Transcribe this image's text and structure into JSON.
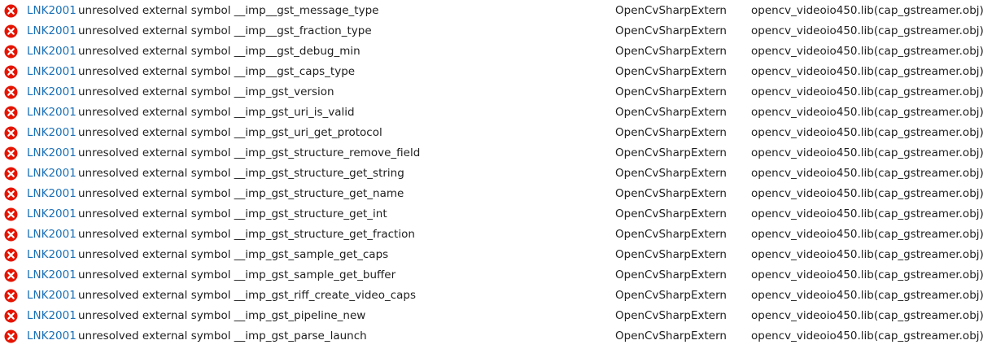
{
  "colors": {
    "error_icon": "#e51400",
    "code_link": "#1a6fb5",
    "text": "#1e1e1e",
    "background": "#ffffff"
  },
  "icons": {
    "row_icon": "error-icon"
  },
  "errors": [
    {
      "code": "LNK2001",
      "description": "unresolved external symbol __imp__gst_message_type",
      "project": "OpenCvSharpExtern",
      "file": "opencv_videoio450.lib(cap_gstreamer.obj)"
    },
    {
      "code": "LNK2001",
      "description": "unresolved external symbol __imp__gst_fraction_type",
      "project": "OpenCvSharpExtern",
      "file": "opencv_videoio450.lib(cap_gstreamer.obj)"
    },
    {
      "code": "LNK2001",
      "description": "unresolved external symbol __imp__gst_debug_min",
      "project": "OpenCvSharpExtern",
      "file": "opencv_videoio450.lib(cap_gstreamer.obj)"
    },
    {
      "code": "LNK2001",
      "description": "unresolved external symbol __imp__gst_caps_type",
      "project": "OpenCvSharpExtern",
      "file": "opencv_videoio450.lib(cap_gstreamer.obj)"
    },
    {
      "code": "LNK2001",
      "description": "unresolved external symbol __imp_gst_version",
      "project": "OpenCvSharpExtern",
      "file": "opencv_videoio450.lib(cap_gstreamer.obj)"
    },
    {
      "code": "LNK2001",
      "description": "unresolved external symbol __imp_gst_uri_is_valid",
      "project": "OpenCvSharpExtern",
      "file": "opencv_videoio450.lib(cap_gstreamer.obj)"
    },
    {
      "code": "LNK2001",
      "description": "unresolved external symbol __imp_gst_uri_get_protocol",
      "project": "OpenCvSharpExtern",
      "file": "opencv_videoio450.lib(cap_gstreamer.obj)"
    },
    {
      "code": "LNK2001",
      "description": "unresolved external symbol __imp_gst_structure_remove_field",
      "project": "OpenCvSharpExtern",
      "file": "opencv_videoio450.lib(cap_gstreamer.obj)"
    },
    {
      "code": "LNK2001",
      "description": "unresolved external symbol __imp_gst_structure_get_string",
      "project": "OpenCvSharpExtern",
      "file": "opencv_videoio450.lib(cap_gstreamer.obj)"
    },
    {
      "code": "LNK2001",
      "description": "unresolved external symbol __imp_gst_structure_get_name",
      "project": "OpenCvSharpExtern",
      "file": "opencv_videoio450.lib(cap_gstreamer.obj)"
    },
    {
      "code": "LNK2001",
      "description": "unresolved external symbol __imp_gst_structure_get_int",
      "project": "OpenCvSharpExtern",
      "file": "opencv_videoio450.lib(cap_gstreamer.obj)"
    },
    {
      "code": "LNK2001",
      "description": "unresolved external symbol __imp_gst_structure_get_fraction",
      "project": "OpenCvSharpExtern",
      "file": "opencv_videoio450.lib(cap_gstreamer.obj)"
    },
    {
      "code": "LNK2001",
      "description": "unresolved external symbol __imp_gst_sample_get_caps",
      "project": "OpenCvSharpExtern",
      "file": "opencv_videoio450.lib(cap_gstreamer.obj)"
    },
    {
      "code": "LNK2001",
      "description": "unresolved external symbol __imp_gst_sample_get_buffer",
      "project": "OpenCvSharpExtern",
      "file": "opencv_videoio450.lib(cap_gstreamer.obj)"
    },
    {
      "code": "LNK2001",
      "description": "unresolved external symbol __imp_gst_riff_create_video_caps",
      "project": "OpenCvSharpExtern",
      "file": "opencv_videoio450.lib(cap_gstreamer.obj)"
    },
    {
      "code": "LNK2001",
      "description": "unresolved external symbol __imp_gst_pipeline_new",
      "project": "OpenCvSharpExtern",
      "file": "opencv_videoio450.lib(cap_gstreamer.obj)"
    },
    {
      "code": "LNK2001",
      "description": "unresolved external symbol __imp_gst_parse_launch",
      "project": "OpenCvSharpExtern",
      "file": "opencv_videoio450.lib(cap_gstreamer.obj)"
    }
  ]
}
